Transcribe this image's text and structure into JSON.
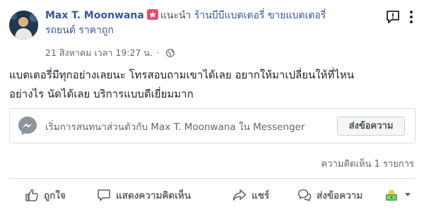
{
  "post": {
    "author_name": "Max T. Moonwana",
    "recommend_label": "แนะนำ",
    "recommended_page_line1": "ร้านบีบีแบตเตอรี่ ขายแบตเตอรี่",
    "recommended_page_line2": "รถยนต์ ราคาถูก",
    "timestamp": "21 สิงหาคม เวลา 19:27 น.",
    "dot": "·",
    "body_line1": "แบตเตอรี่มีทุกอย่างเลยนะ โทรสอบถามเขาได้เลย อยากให้มาเปลี่ยนให้ที่ไหน",
    "body_line2": "อย่างไร นัดได้เลย บริการแบบดีเยี่ยมมาก",
    "icons": {
      "message": "message-exclamation-icon",
      "more": "vertical-ellipsis-icon",
      "globe": "globe-icon",
      "messenger": "messenger-icon"
    }
  },
  "messenger_prompt": {
    "label": "เริ่มการสนทนาส่วนตัวกับ Max T. Moonwana ใน Messenger",
    "button": "ส่งข้อความ"
  },
  "comments": {
    "count_label": "ความคิดเห็น 1 รายการ"
  },
  "actions": {
    "like": "ถูกใจ",
    "comment": "แสดงความคิดเห็น",
    "share": "แชร์",
    "send": "ส่งข้อความ"
  },
  "colors": {
    "link": "#365899",
    "recommend_badge": "#e84a6d",
    "secondary_text": "#616770",
    "action_text": "#606770"
  }
}
